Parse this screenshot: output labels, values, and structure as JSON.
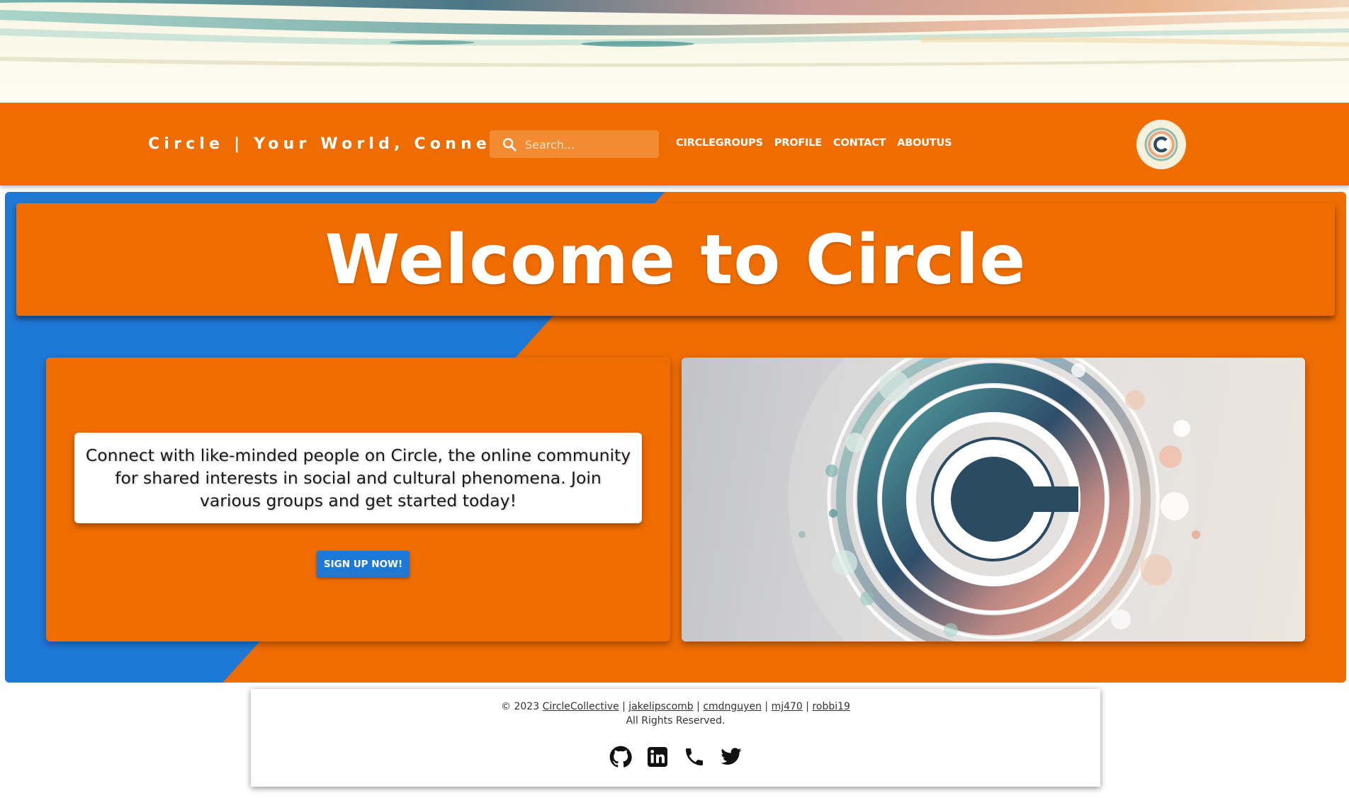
{
  "header": {
    "brand": "Circle | Your World, Connected",
    "search": {
      "placeholder": "Search...",
      "value": "",
      "icon": "search-icon"
    },
    "nav": [
      {
        "label": "CIRCLEGROUPS"
      },
      {
        "label": "PROFILE"
      },
      {
        "label": "CONTACT"
      },
      {
        "label": "ABOUTUS"
      }
    ],
    "logo_icon": "circle-c-logo"
  },
  "hero": {
    "title": "Welcome to Circle",
    "intro": "Connect with like-minded people on Circle, the online community for shared interests in social and cultural phenomena. Join various groups and get started today!",
    "signup_label": "SIGN UP NOW!",
    "image_icon": "circle-c-logo"
  },
  "footer": {
    "copyright": "© 2023",
    "org": "CircleCollective",
    "separator": "|",
    "members": [
      "jakelipscomb",
      "cmdnguyen",
      "mj470",
      "robbi19"
    ],
    "rights": "All Rights Reserved.",
    "icons": [
      "github-icon",
      "linkedin-icon",
      "phone-icon",
      "twitter-icon"
    ]
  },
  "colors": {
    "primary_orange": "#ef6c00",
    "accent_blue": "#1e78d6",
    "white": "#ffffff"
  }
}
